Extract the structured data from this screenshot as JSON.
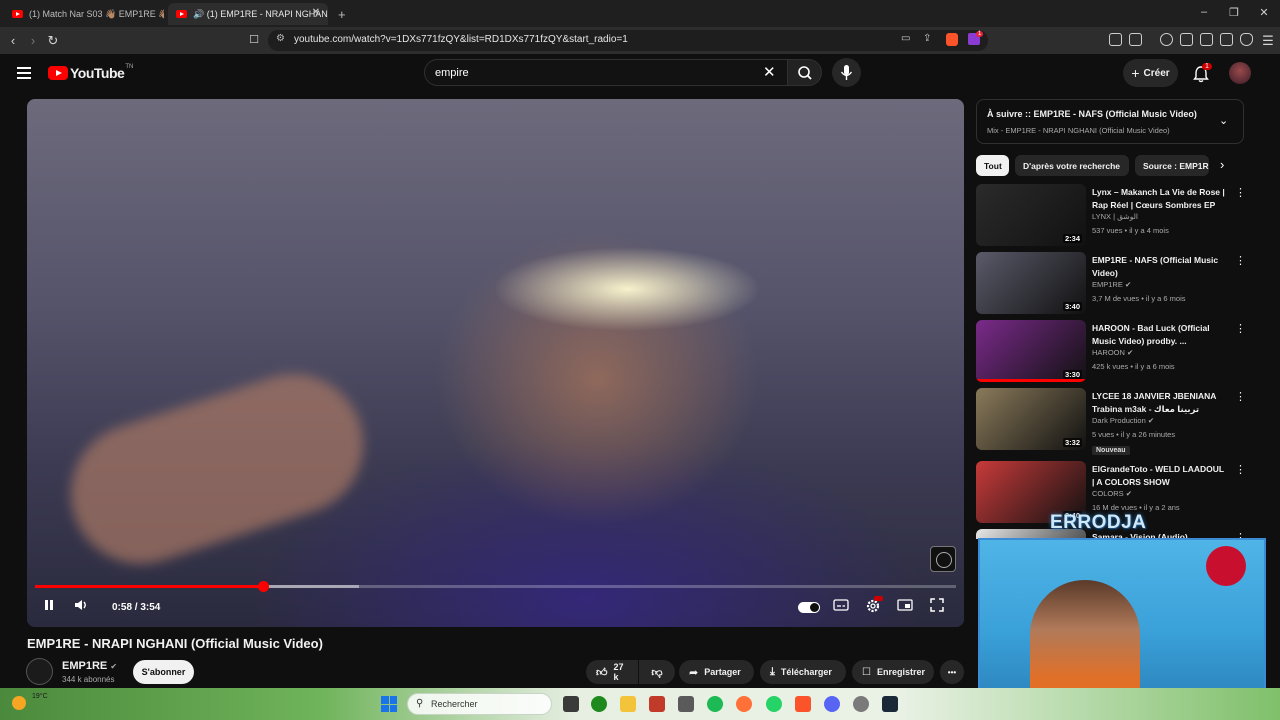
{
  "browser": {
    "tabs": [
      {
        "label": "(1) Match Nar S03 👋🏽 EMP1RE 👋🏽 -",
        "active": false
      },
      {
        "label": "🔊 (1) EMP1RE - NRAPI NGHANI",
        "active": true
      }
    ],
    "new_tab": "+",
    "url": "youtube.com/watch?v=1DXs771fzQY&list=RD1DXs771fzQY&start_radio=1",
    "extension_badge": "1",
    "window_controls": {
      "minimize": "–",
      "restore": "❐",
      "close": "✕"
    }
  },
  "masthead": {
    "logo_text": "YouTube",
    "logo_suffix": "TN",
    "search_value": "empire",
    "create_label": "Créer",
    "notification_count": "1"
  },
  "player": {
    "current_time": "0:58",
    "duration": "3:54",
    "time_display": "0:58 / 3:54",
    "played_fraction": 0.248,
    "buffered_fraction": 0.352
  },
  "video": {
    "title": "EMP1RE - NRAPI NGHANI (Official Music Video)",
    "channel": "EMP1RE",
    "subscribers": "344 k abonnés",
    "subscribe_label": "S'abonner",
    "likes": "27 k",
    "share_label": "Partager",
    "download_label": "Télécharger",
    "save_label": "Enregistrer",
    "more_label": "•••"
  },
  "sidebar": {
    "up_next_title": "À suivre :: EMP1RE - NAFS (Official Music Video)",
    "up_next_sub": "Mix - EMP1RE - NRAPI NGHANI (Official Music Video)",
    "chips": [
      "Tout",
      "D'après votre recherche",
      "Source : EMP1RE"
    ],
    "recommendations": [
      {
        "title": "Lynx – Makanch La Vie de Rose | Rap Réel | Cœurs Sombres EP",
        "channel": "LYNX | الوشق",
        "meta": "537 vues • il y a 4 mois",
        "duration": "2:34",
        "verified": false,
        "thumb_color": "#2b2b2b"
      },
      {
        "title": "EMP1RE - NAFS (Official Music Video)",
        "channel": "EMP1RE",
        "meta": "3,7 M de vues • il y a 6 mois",
        "duration": "3:40",
        "verified": true,
        "thumb_color": "#5a5a6a"
      },
      {
        "title": "HAROON - Bad Luck (Official Music Video)  prodby. ...",
        "channel": "HAROON",
        "meta": "425 k vues • il y a 6 mois",
        "duration": "3:30",
        "verified": true,
        "thumb_color": "#7a2a8a"
      },
      {
        "title": "LYCEE 18 JANVIER JBENIANA Trabina m3ak - تربينا معاك",
        "channel": "Dark Production",
        "meta": "5 vues • il y a 26 minutes",
        "duration": "3:32",
        "verified": true,
        "badge": "Nouveau",
        "thumb_color": "#8a7a5a"
      },
      {
        "title": "ElGrandeToto - WELD LAADOUL | A COLORS SHOW",
        "channel": "COLORS",
        "meta": "16 M de vues • il y a 2 ans",
        "duration": "3:40",
        "verified": true,
        "thumb_color": "#c83a3a"
      },
      {
        "title": "Samara - Vision (Audio)",
        "channel": "",
        "meta": "",
        "duration": "",
        "verified": false,
        "thumb_color": "#e8e8e8"
      }
    ]
  },
  "overlay": {
    "streamer_name": "ERRODJA"
  },
  "taskbar": {
    "weather": "19°C",
    "search_placeholder": "Rechercher"
  }
}
